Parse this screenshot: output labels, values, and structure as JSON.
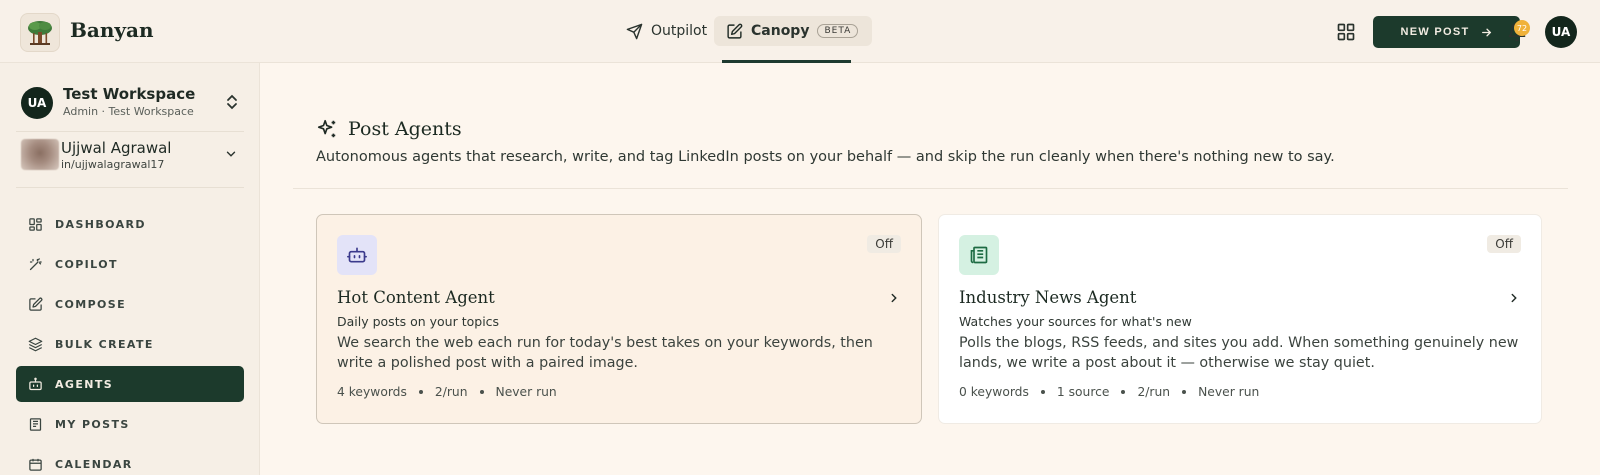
{
  "app": {
    "brand": "Banyan"
  },
  "topnav": {
    "tabs": [
      {
        "label": "Outpilot",
        "icon": "send-icon"
      },
      {
        "label": "Canopy",
        "icon": "edit-icon",
        "badge": "BETA",
        "active": true
      }
    ],
    "new_post_label": "NEW POST",
    "notification_count": "72",
    "avatar_initials": "UA"
  },
  "sidebar": {
    "workspace": {
      "initials": "UA",
      "name": "Test Workspace",
      "role": "Admin · Test Workspace"
    },
    "user": {
      "name": "Ujjwal Agrawal",
      "handle": "in/ujjwalagrawal17"
    },
    "items": [
      {
        "label": "DASHBOARD",
        "icon": "dashboard-icon"
      },
      {
        "label": "COPILOT",
        "icon": "magic-wand-icon"
      },
      {
        "label": "COMPOSE",
        "icon": "compose-icon"
      },
      {
        "label": "BULK CREATE",
        "icon": "layers-icon"
      },
      {
        "label": "AGENTS",
        "icon": "robot-icon",
        "active": true
      },
      {
        "label": "MY POSTS",
        "icon": "newspaper-icon"
      },
      {
        "label": "CALENDAR",
        "icon": "calendar-icon"
      }
    ]
  },
  "main": {
    "title": "Post Agents",
    "description": "Autonomous agents that research, write, and tag LinkedIn posts on your behalf — and skip the run cleanly when there's nothing new to say.",
    "cards": [
      {
        "title": "Hot Content Agent",
        "status": "Off",
        "subtitle": "Daily posts on your topics",
        "description": "We search the web each run for today's best takes on your keywords, then write a polished post with a paired image.",
        "meta": [
          "4 keywords",
          "2/run",
          "Never run"
        ]
      },
      {
        "title": "Industry News Agent",
        "status": "Off",
        "subtitle": "Watches your sources for what's new",
        "description": "Polls the blogs, RSS feeds, and sites you add. When something genuinely new lands, we write a post about it — otherwise we stay quiet.",
        "meta": [
          "0 keywords",
          "1 source",
          "2/run",
          "Never run"
        ]
      }
    ]
  },
  "colors": {
    "accent": "#1c3a2c",
    "background": "#fdf6ee",
    "badge": "#f0b23a"
  }
}
